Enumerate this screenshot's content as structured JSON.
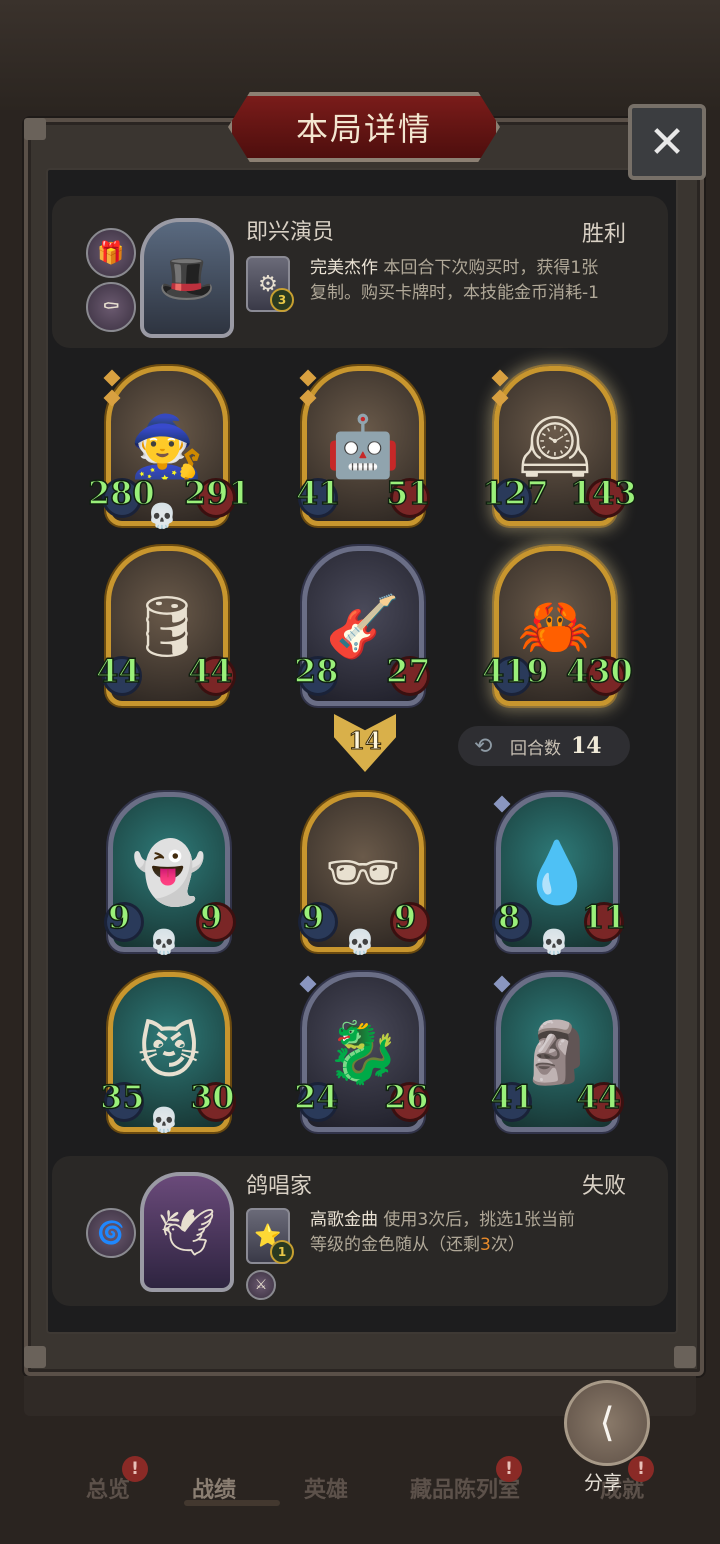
{
  "title": "本局详情",
  "close_icon_glyph": "✕",
  "top_player": {
    "name": "即兴演员",
    "result": "胜利",
    "skill_name": "完美杰作",
    "skill_line1": " 本回合下次购买时，获得1张",
    "skill_line2": "复制。购买卡牌时，本技能金币消耗-1",
    "skill_level": "3",
    "traits": [
      "gift-box-icon",
      "coffin-icon"
    ]
  },
  "top_minions": [
    {
      "name": "wizard-minion",
      "attack": "280",
      "health": "291",
      "frame": "gold",
      "dead": true
    },
    {
      "name": "cyborg-minion",
      "attack": "41",
      "health": "51",
      "frame": "gold",
      "dead": false
    },
    {
      "name": "clock-minion",
      "attack": "127",
      "health": "143",
      "frame": "gold",
      "dead": false
    },
    {
      "name": "diving-bell-minion",
      "attack": "44",
      "health": "44",
      "frame": "gold",
      "dead": false
    },
    {
      "name": "rocker-minion",
      "attack": "28",
      "health": "27",
      "frame": "silver",
      "dead": false
    },
    {
      "name": "crab-mech-minion",
      "attack": "419",
      "health": "430",
      "frame": "gold",
      "dead": false
    }
  ],
  "turn_marker": "14",
  "round": {
    "label": "回合数",
    "value": "14"
  },
  "bottom_minions": [
    {
      "name": "ghost-lady-minion",
      "attack": "9",
      "health": "9",
      "frame": "silver",
      "dead": true
    },
    {
      "name": "hooded-shade-minion",
      "attack": "9",
      "health": "9",
      "frame": "gold",
      "dead": true
    },
    {
      "name": "slime-ghost-minion",
      "attack": "8",
      "health": "11",
      "frame": "silver",
      "dead": true
    },
    {
      "name": "ghost-cat-lady-minion",
      "attack": "35",
      "health": "30",
      "frame": "gold",
      "dead": true
    },
    {
      "name": "dragon-minion",
      "attack": "24",
      "health": "26",
      "frame": "silver",
      "dead": false
    },
    {
      "name": "ghost-brute-minion",
      "attack": "41",
      "health": "44",
      "frame": "silver",
      "dead": false
    }
  ],
  "bottom_player": {
    "name": "鸽唱家",
    "result": "失败",
    "skill_name": "高歌金曲",
    "skill_line1": " 使用3次后，挑选1张当前",
    "skill_line2_a": "等级的金色随从（还剩",
    "skill_line2_hl": "3",
    "skill_line2_b": "次）",
    "skill_level": "1",
    "traits": [
      "spirit-icon"
    ]
  },
  "nav": {
    "items": [
      "总览",
      "战绩",
      "英雄",
      "藏品陈列室",
      "成就"
    ],
    "active": "战绩"
  },
  "share_label": "分享"
}
